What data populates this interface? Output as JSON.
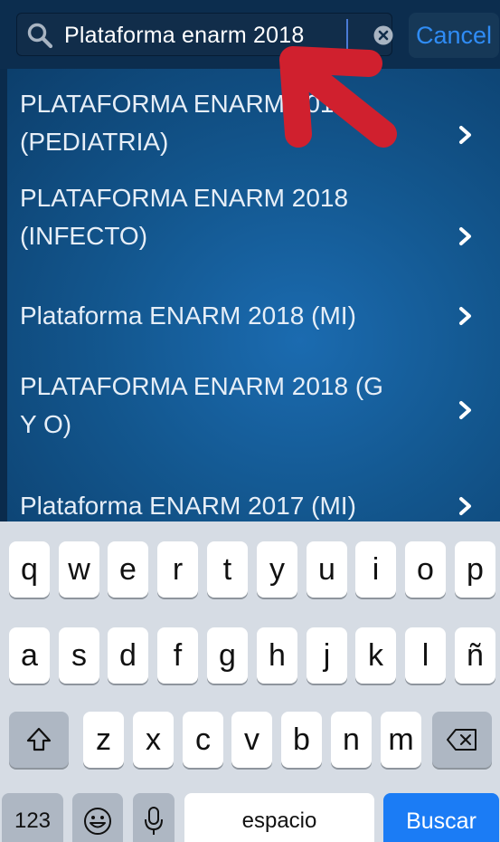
{
  "search": {
    "query": "Plataforma enarm 2018",
    "cancel_label": "Cancel"
  },
  "results": [
    {
      "label_line1": "PLATAFORMA ENARM 2018",
      "label_line2": "(PEDIATRIA)"
    },
    {
      "label_line1": "PLATAFORMA ENARM 2018",
      "label_line2": "(INFECTO)"
    },
    {
      "label_line1": "Plataforma ENARM 2018  (MI)",
      "label_line2": ""
    },
    {
      "label_line1": "PLATAFORMA ENARM 2018 (G",
      "label_line2": "Y O)"
    },
    {
      "label_line1": "Plataforma ENARM 2017  (MI)",
      "label_line2": ""
    }
  ],
  "keyboard": {
    "row1": [
      "q",
      "w",
      "e",
      "r",
      "t",
      "y",
      "u",
      "i",
      "o",
      "p"
    ],
    "row2": [
      "a",
      "s",
      "d",
      "f",
      "g",
      "h",
      "j",
      "k",
      "l",
      "ñ"
    ],
    "row3": [
      "z",
      "x",
      "c",
      "v",
      "b",
      "n",
      "m"
    ],
    "numbers_label": "123",
    "space_label": "espacio",
    "return_label": "Buscar"
  },
  "colors": {
    "accent": "#2f8cf5",
    "annotation_arrow": "#d0202e",
    "return_key": "#1b7cf5"
  },
  "icons": {
    "search": "magnifier-icon",
    "clear": "clear-circle-x-icon",
    "row_chevron": "chevron-right-icon",
    "shift": "shift-arrow-icon",
    "delete": "backspace-icon",
    "emoji": "smiley-icon",
    "dictation": "microphone-icon"
  }
}
